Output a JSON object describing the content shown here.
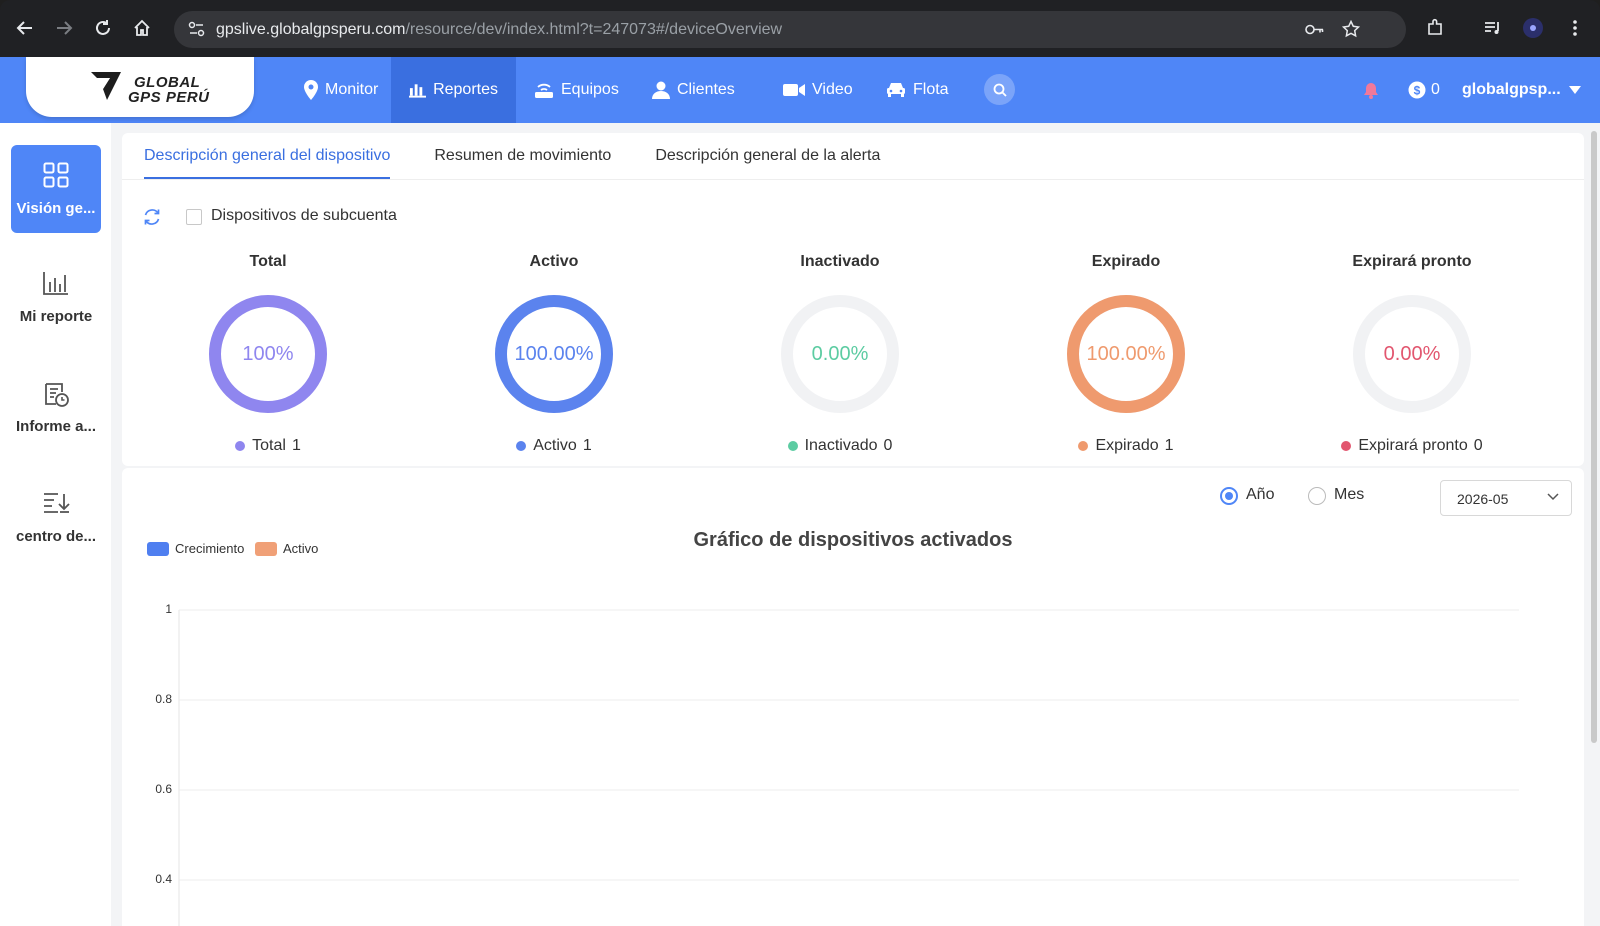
{
  "browser": {
    "url_host": "gpslive.globalgpsperu.com",
    "url_path": "/resource/dev/index.html?t=247073#/deviceOverview"
  },
  "header": {
    "logo_line1": "GLOBAL",
    "logo_line2": "GPS PERÚ",
    "nav": [
      {
        "label": "Monitor",
        "icon": "location-pin-icon"
      },
      {
        "label": "Reportes",
        "icon": "bar-chart-icon"
      },
      {
        "label": "Equipos",
        "icon": "router-icon"
      },
      {
        "label": "Clientes",
        "icon": "user-icon"
      },
      {
        "label": "Video",
        "icon": "video-camera-icon"
      },
      {
        "label": "Flota",
        "icon": "car-icon"
      }
    ],
    "balance": "0",
    "user": "globalgpsp..."
  },
  "sidebar": {
    "items": [
      {
        "label": "Visión ge...",
        "icon": "grid-icon"
      },
      {
        "label": "Mi reporte",
        "icon": "bar-chart-icon"
      },
      {
        "label": "Informe a...",
        "icon": "report-clock-icon"
      },
      {
        "label": "centro de...",
        "icon": "download-list-icon"
      }
    ]
  },
  "tabs": [
    "Descripción general del dispositivo",
    "Resumen de movimiento",
    "Descripción general de la alerta"
  ],
  "subaccount_label": "Dispositivos de subcuenta",
  "stats": [
    {
      "title": "Total",
      "percent": "100%",
      "fraction": 1,
      "legend": "Total",
      "count": "1",
      "color": "#8f86ef"
    },
    {
      "title": "Activo",
      "percent": "100.00%",
      "fraction": 1,
      "legend": "Activo",
      "count": "1",
      "color": "#5b83ee"
    },
    {
      "title": "Inactivado",
      "percent": "0.00%",
      "fraction": 0,
      "legend": "Inactivado",
      "count": "0",
      "color": "#5ccca2"
    },
    {
      "title": "Expirado",
      "percent": "100.00%",
      "fraction": 1,
      "legend": "Expirado",
      "count": "1",
      "color": "#ef9a6e"
    },
    {
      "title": "Expirará pronto",
      "percent": "0.00%",
      "fraction": 0,
      "legend": "Expirará pronto",
      "count": "0",
      "color": "#e2566f"
    }
  ],
  "chart_controls": {
    "year_label": "Año",
    "month_label": "Mes",
    "selected": "Año",
    "period": "2026-05"
  },
  "chart_data": {
    "type": "bar",
    "title": "Gráfico de dispositivos activados",
    "series": [
      {
        "name": "Crecimiento",
        "color": "#4f7ff0",
        "values": []
      },
      {
        "name": "Activo",
        "color": "#f0a077",
        "values": []
      }
    ],
    "y_ticks": [
      "1",
      "0.8",
      "0.6",
      "0.4"
    ],
    "ylim": [
      0,
      1
    ],
    "grid": true,
    "legend": "top-left"
  }
}
